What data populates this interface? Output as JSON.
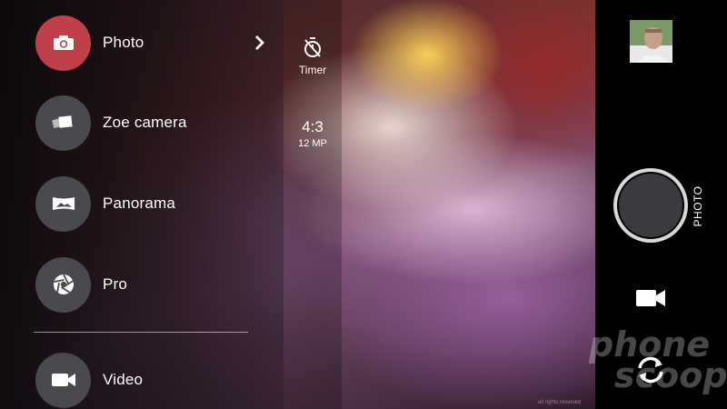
{
  "modes": [
    {
      "id": "photo",
      "label": "Photo",
      "icon": "camera-icon",
      "active": true
    },
    {
      "id": "zoe",
      "label": "Zoe camera",
      "icon": "zoe-camera-icon",
      "active": false
    },
    {
      "id": "panorama",
      "label": "Panorama",
      "icon": "panorama-icon",
      "active": false
    },
    {
      "id": "pro",
      "label": "Pro",
      "icon": "aperture-icon",
      "active": false
    },
    {
      "id": "video",
      "label": "Video",
      "icon": "video-camera-icon",
      "active": false
    }
  ],
  "settings": {
    "timer_label": "Timer",
    "aspect_ratio": "4:3",
    "resolution": "12 MP"
  },
  "right_panel": {
    "current_mode_label": "PHOTO"
  },
  "watermark": {
    "line1": "phone",
    "line2": "scoop"
  },
  "caption": "all rights reserved",
  "colors": {
    "active_mode": "#c0404a",
    "mode_circle": "#4a4a4e",
    "shutter_ring": "#d8d8d8",
    "shutter_fill": "#3a3b3f"
  }
}
